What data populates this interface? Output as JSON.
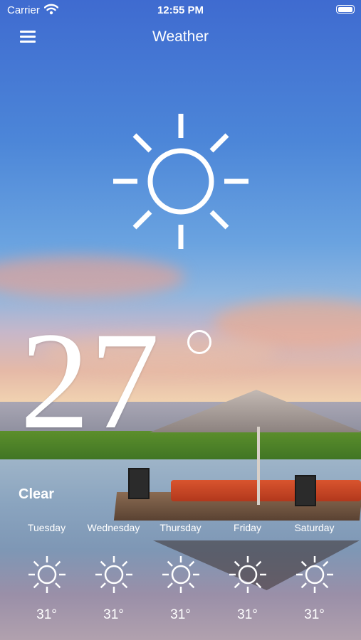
{
  "status_bar": {
    "carrier": "Carrier",
    "time": "12:55 PM"
  },
  "nav": {
    "title": "Weather",
    "menu_icon": "hamburger-menu-icon"
  },
  "current": {
    "temperature": "27",
    "condition": "Clear",
    "icon": "sun-icon"
  },
  "forecast": [
    {
      "day": "Tuesday",
      "temp": "31°",
      "icon": "sun-icon"
    },
    {
      "day": "Wednesday",
      "temp": "31°",
      "icon": "sun-icon"
    },
    {
      "day": "Thursday",
      "temp": "31°",
      "icon": "sun-icon"
    },
    {
      "day": "Friday",
      "temp": "31°",
      "icon": "sun-icon"
    },
    {
      "day": "Saturday",
      "temp": "31°",
      "icon": "sun-icon"
    }
  ],
  "colors": {
    "text": "#ffffff",
    "sky_top": "#3f6bd0"
  }
}
